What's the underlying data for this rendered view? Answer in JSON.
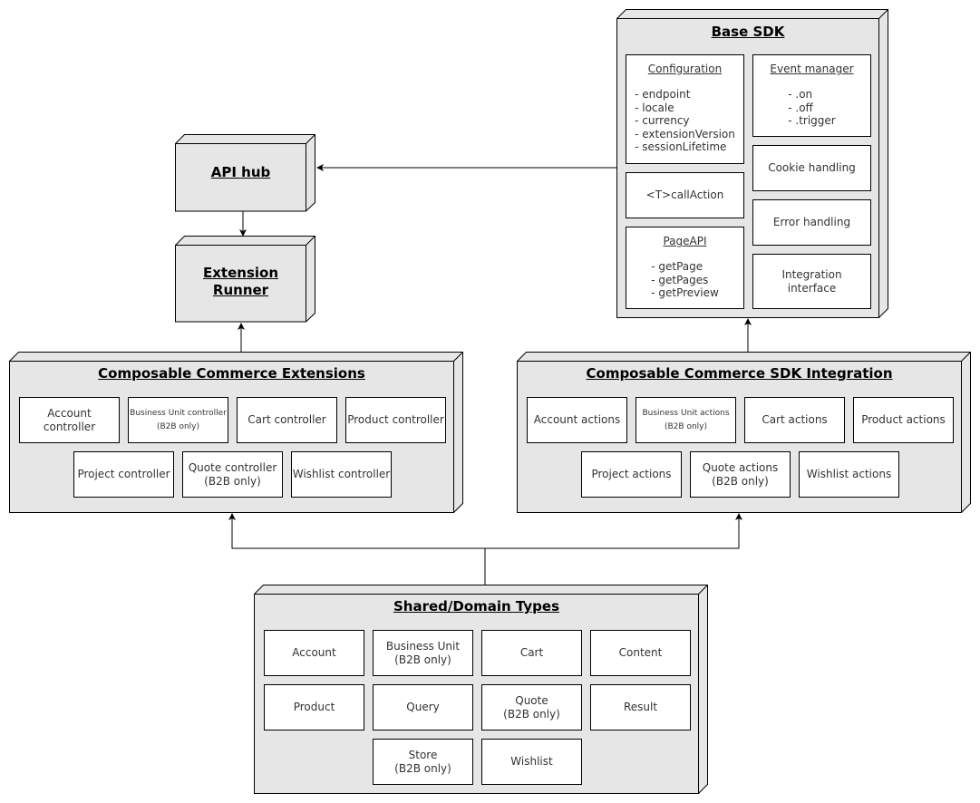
{
  "colors": {
    "box_fill": "#e6e6e6",
    "cell_fill": "#ffffff",
    "stroke": "#000000",
    "text": "#333333"
  },
  "api_hub": {
    "title": "API hub"
  },
  "extension_runner": {
    "title_line1": "Extension",
    "title_line2": "Runner"
  },
  "base_sdk": {
    "title": "Base SDK",
    "configuration": {
      "title": "Configuration",
      "items": [
        "- endpoint",
        "- locale",
        "- currency",
        "- extensionVersion",
        "- sessionLifetime"
      ]
    },
    "event_manager": {
      "title": "Event manager",
      "items": [
        "- .on",
        "- .off",
        "- .trigger"
      ]
    },
    "cookie_handling": "Cookie handling",
    "call_action": "<T>callAction",
    "error_handling": "Error handling",
    "page_api": {
      "title": "PageAPI",
      "items": [
        "- getPage",
        "- getPages",
        "- getPreview"
      ]
    },
    "integration_interface_line1": "Integration",
    "integration_interface_line2": "interface"
  },
  "extensions": {
    "title": "Composable Commerce Extensions",
    "row1": [
      "Account controller",
      "Business Unit controller",
      "Cart controller",
      "Product controller"
    ],
    "row1_note": "(B2B only)",
    "row2": [
      "Project controller",
      "Quote controller",
      "Wishlist controller"
    ],
    "row2_note": "(B2B only)"
  },
  "sdk_integration": {
    "title": "Composable Commerce SDK Integration",
    "row1": [
      "Account actions",
      "Business Unit actions",
      "Cart actions",
      "Product actions"
    ],
    "row1_note": "(B2B only)",
    "row2": [
      "Project actions",
      "Quote actions",
      "Wishlist actions"
    ],
    "row2_note": "(B2B only)"
  },
  "shared_types": {
    "title": "Shared/Domain Types",
    "row1": [
      "Account",
      "Business Unit",
      "Cart",
      "Content"
    ],
    "row2": [
      "Product",
      "Query",
      "Quote",
      "Result"
    ],
    "row3": [
      "Store",
      "Wishlist"
    ],
    "b2b_note": "(B2B only)"
  }
}
